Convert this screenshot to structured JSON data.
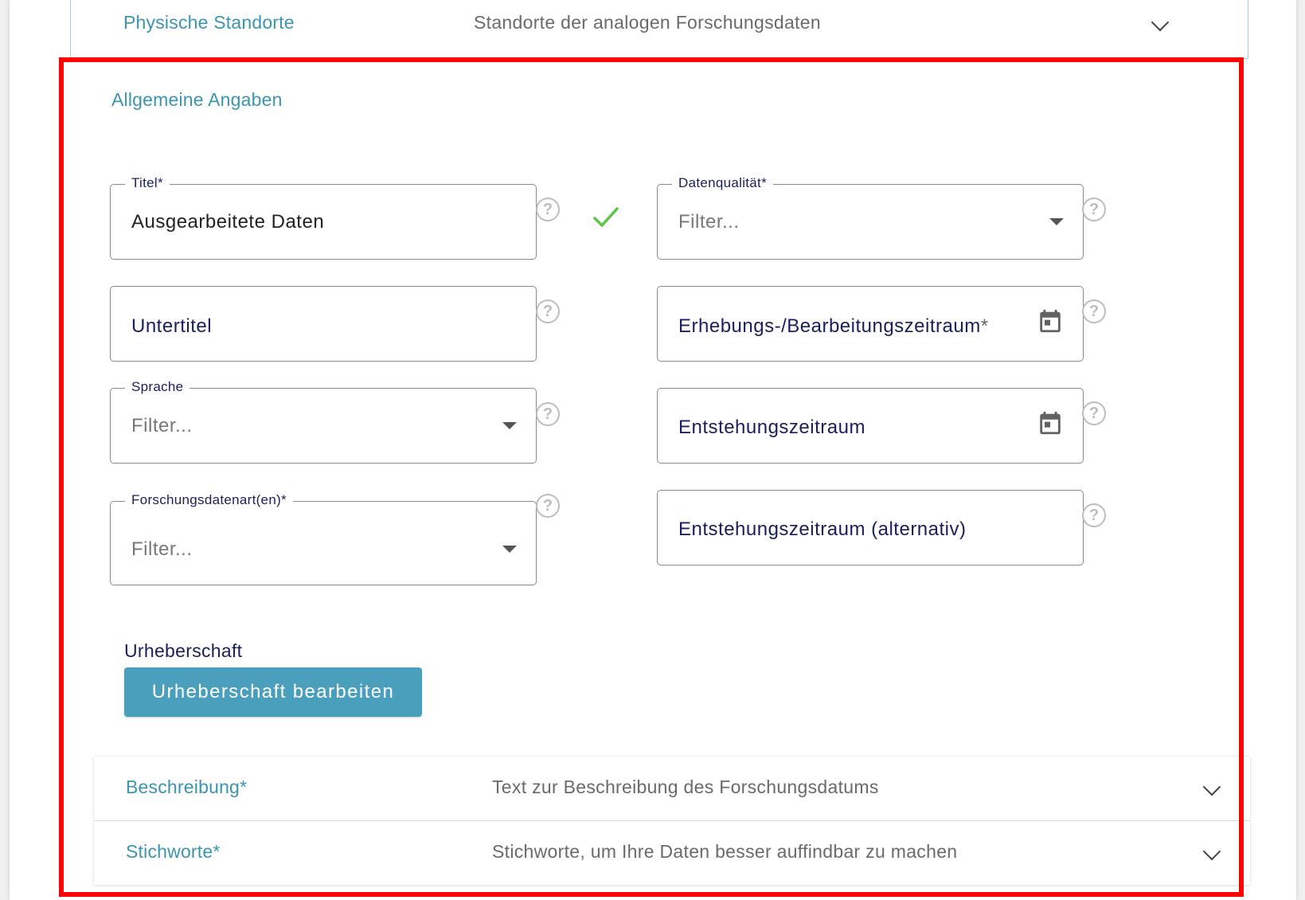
{
  "top_panel": {
    "title": "Physische Standorte",
    "description": "Standorte der analogen Forschungsdaten"
  },
  "section": {
    "title": "Allgemeine Angaben"
  },
  "fields": {
    "titel": {
      "label": "Titel*",
      "value": "Ausgearbeitete Daten"
    },
    "untertitel": {
      "label": "Untertitel"
    },
    "sprache": {
      "label": "Sprache",
      "placeholder": "Filter..."
    },
    "forschungsdatenart": {
      "label": "Forschungsdatenart(en)*",
      "placeholder": "Filter..."
    },
    "datenqualitaet": {
      "label": "Datenqualität*",
      "placeholder": "Filter..."
    },
    "erhebungszeitraum": {
      "label": "Erhebungs-/Bearbeitungszeitraum",
      "required_mark": "*"
    },
    "entstehungszeitraum": {
      "label": "Entstehungszeitraum"
    },
    "entstehungszeitraum_alt": {
      "label": "Entstehungszeitraum (alternativ)"
    }
  },
  "urheberschaft": {
    "heading": "Urheberschaft",
    "button_label": "Urheberschaft bearbeiten"
  },
  "accordions": [
    {
      "title": "Beschreibung*",
      "description": "Text zur Beschreibung des Forschungsdatums"
    },
    {
      "title": "Stichworte*",
      "description": "Stichworte, um Ihre Daten besser auffindbar zu machen"
    }
  ],
  "icons": {
    "help": "question-circle-icon",
    "calendar": "calendar-icon",
    "check": "check-icon",
    "dropdown": "dropdown-arrow-icon",
    "chevron": "chevron-down-icon"
  },
  "colors": {
    "accent": "#3a95b2",
    "button": "#4a9fbd",
    "check": "#5cc54a",
    "highlight_border": "#ff0000",
    "label_text": "#1a1f5c"
  }
}
